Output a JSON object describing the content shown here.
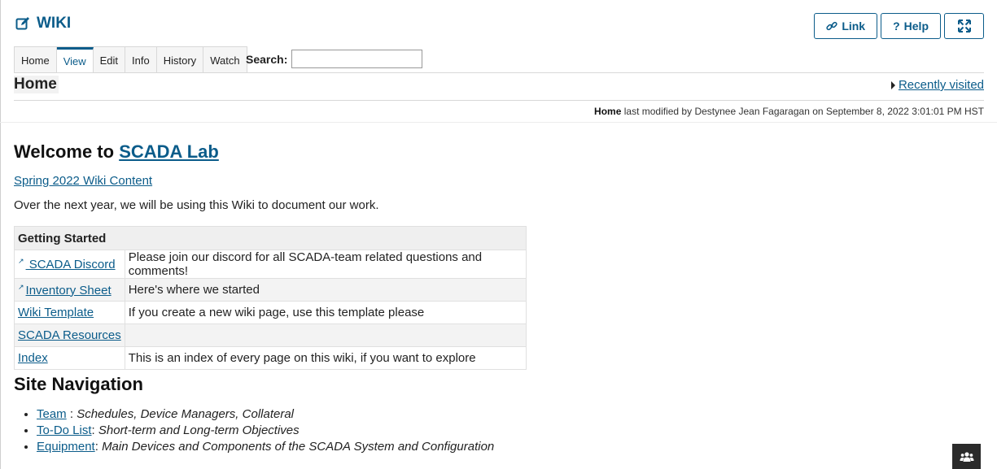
{
  "header": {
    "title": "WIKI",
    "buttons": {
      "link": "Link",
      "help": "Help"
    }
  },
  "tabs": [
    "Home",
    "View",
    "Edit",
    "Info",
    "History",
    "Watch"
  ],
  "active_tab": "View",
  "search": {
    "label": "Search:",
    "value": ""
  },
  "page": {
    "name": "Home",
    "recently_visited": "Recently visited",
    "modified_page": "Home",
    "modified_text": "last modified by Destynee Jean Fagaragan on September 8, 2022 3:01:01 PM HST"
  },
  "content": {
    "welcome_prefix": "Welcome to ",
    "welcome_link": "SCADA Lab",
    "spring_link": "Spring 2022 Wiki Content",
    "intro": "Over the next year, we will be using this Wiki to document our work.",
    "table_header": "Getting Started",
    "table_rows": [
      {
        "link": " SCADA Discord",
        "external": true,
        "desc": "Please join our discord for all SCADA-team related questions and comments!"
      },
      {
        "link": "Inventory Sheet",
        "external": true,
        "desc": "Here's where we started"
      },
      {
        "link": "Wiki Template",
        "external": false,
        "desc": "If you create a new wiki page, use this template please"
      },
      {
        "link": "SCADA Resources",
        "external": false,
        "desc": ""
      },
      {
        "link": "Index",
        "external": false,
        "desc": "This is an index of every page on this wiki, if you want to explore"
      }
    ],
    "site_nav_title": "Site Navigation",
    "nav_items": [
      {
        "link": "Team",
        "sep": " : ",
        "desc": "Schedules, Device Managers, Collateral"
      },
      {
        "link": "To-Do List",
        "sep": ": ",
        "desc": "Short-term and Long-term Objectives"
      },
      {
        "link": "Equipment",
        "sep": ": ",
        "desc": "Main Devices and Components of the SCADA System and Configuration"
      }
    ]
  },
  "colors": {
    "accent": "#0b5c8a",
    "table_header": "#efefef"
  },
  "icons": [
    "edit-icon",
    "link-icon",
    "help-icon",
    "expand-icon",
    "external-link-icon",
    "people-icon"
  ]
}
